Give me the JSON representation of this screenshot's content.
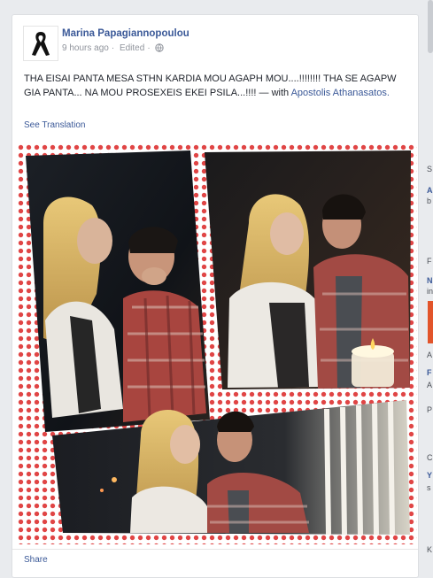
{
  "post": {
    "author": "Marina Papagiannopoulou",
    "time": "9 hours ago",
    "edited": "Edited",
    "status_text": "THA EISAI PANTA MESA STHN KARDIA MOU AGAPH MOU....!!!!!!!! THA SE AGAPW GIA PANTA... NA MOU PROSEXEIS EKEI PSILA...!!!!",
    "with_prefix": "— with",
    "tagged": "Apostolis Athanasatos.",
    "see_translation": "See Translation",
    "share": "Share",
    "avatar_icon": "black-mourning-ribbon-icon",
    "privacy_icon": "globe-icon"
  },
  "colors": {
    "link": "#3b5998",
    "polka_dot": "#e04545",
    "background": "#e9ebee"
  },
  "edge_glyphs": [
    "S",
    "A",
    "b",
    "F",
    "N",
    "in",
    "A",
    "F",
    "A",
    "P",
    "C",
    "Y",
    "s",
    "K"
  ]
}
